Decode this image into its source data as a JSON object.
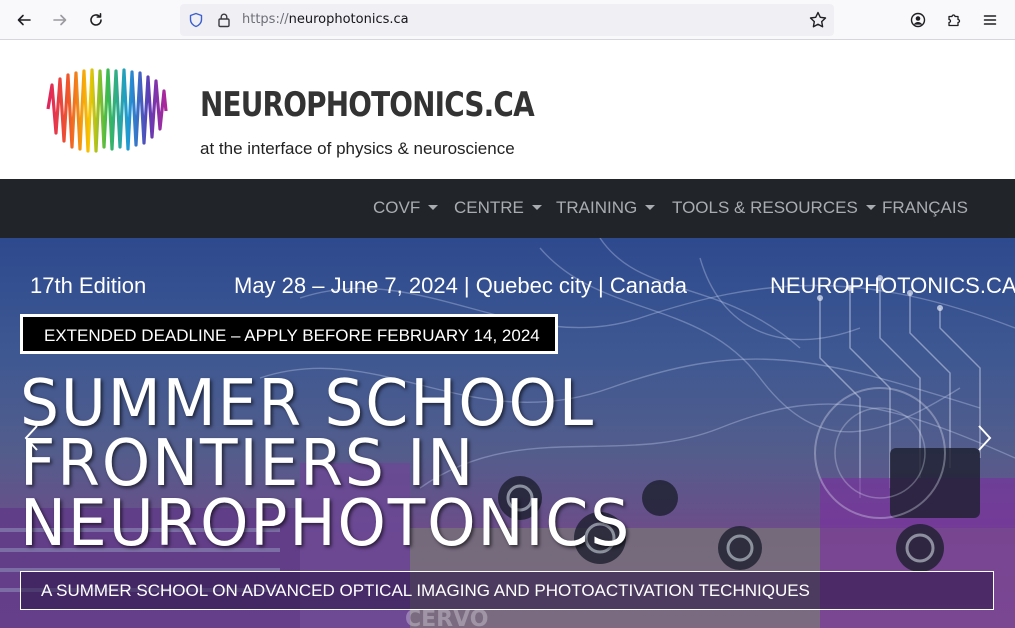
{
  "browser": {
    "url_scheme": "https://",
    "url_host": "neurophotonics.ca"
  },
  "header": {
    "title": "NEUROPHOTONICS.CA",
    "tagline": "at the interface of physics & neuroscience"
  },
  "nav": {
    "items": [
      {
        "label": "COVF",
        "dropdown": true
      },
      {
        "label": "CENTRE",
        "dropdown": true
      },
      {
        "label": "TRAINING",
        "dropdown": true
      },
      {
        "label": "TOOLS & RESOURCES",
        "dropdown": true
      },
      {
        "label": "FRANÇAIS",
        "dropdown": false
      }
    ]
  },
  "hero": {
    "edition": "17th Edition",
    "dates": "May 28 – June 7, 2024 | Quebec city | Canada",
    "site": "NEUROPHOTONICS.CA",
    "deadline": "EXTENDED DEADLINE – APPLY BEFORE FEBRUARY 14, 2024",
    "title_line1": "SUMMER SCHOOL",
    "title_line2": "FRONTIERS IN",
    "title_line3": "NEUROPHOTONICS",
    "subtitle": "A SUMMER SCHOOL ON ADVANCED OPTICAL IMAGING AND PHOTOACTIVATION TECHNIQUES"
  },
  "colors": {
    "nav_bg": "#212529",
    "nav_text": "#a9adb1",
    "title_text": "#333333"
  }
}
